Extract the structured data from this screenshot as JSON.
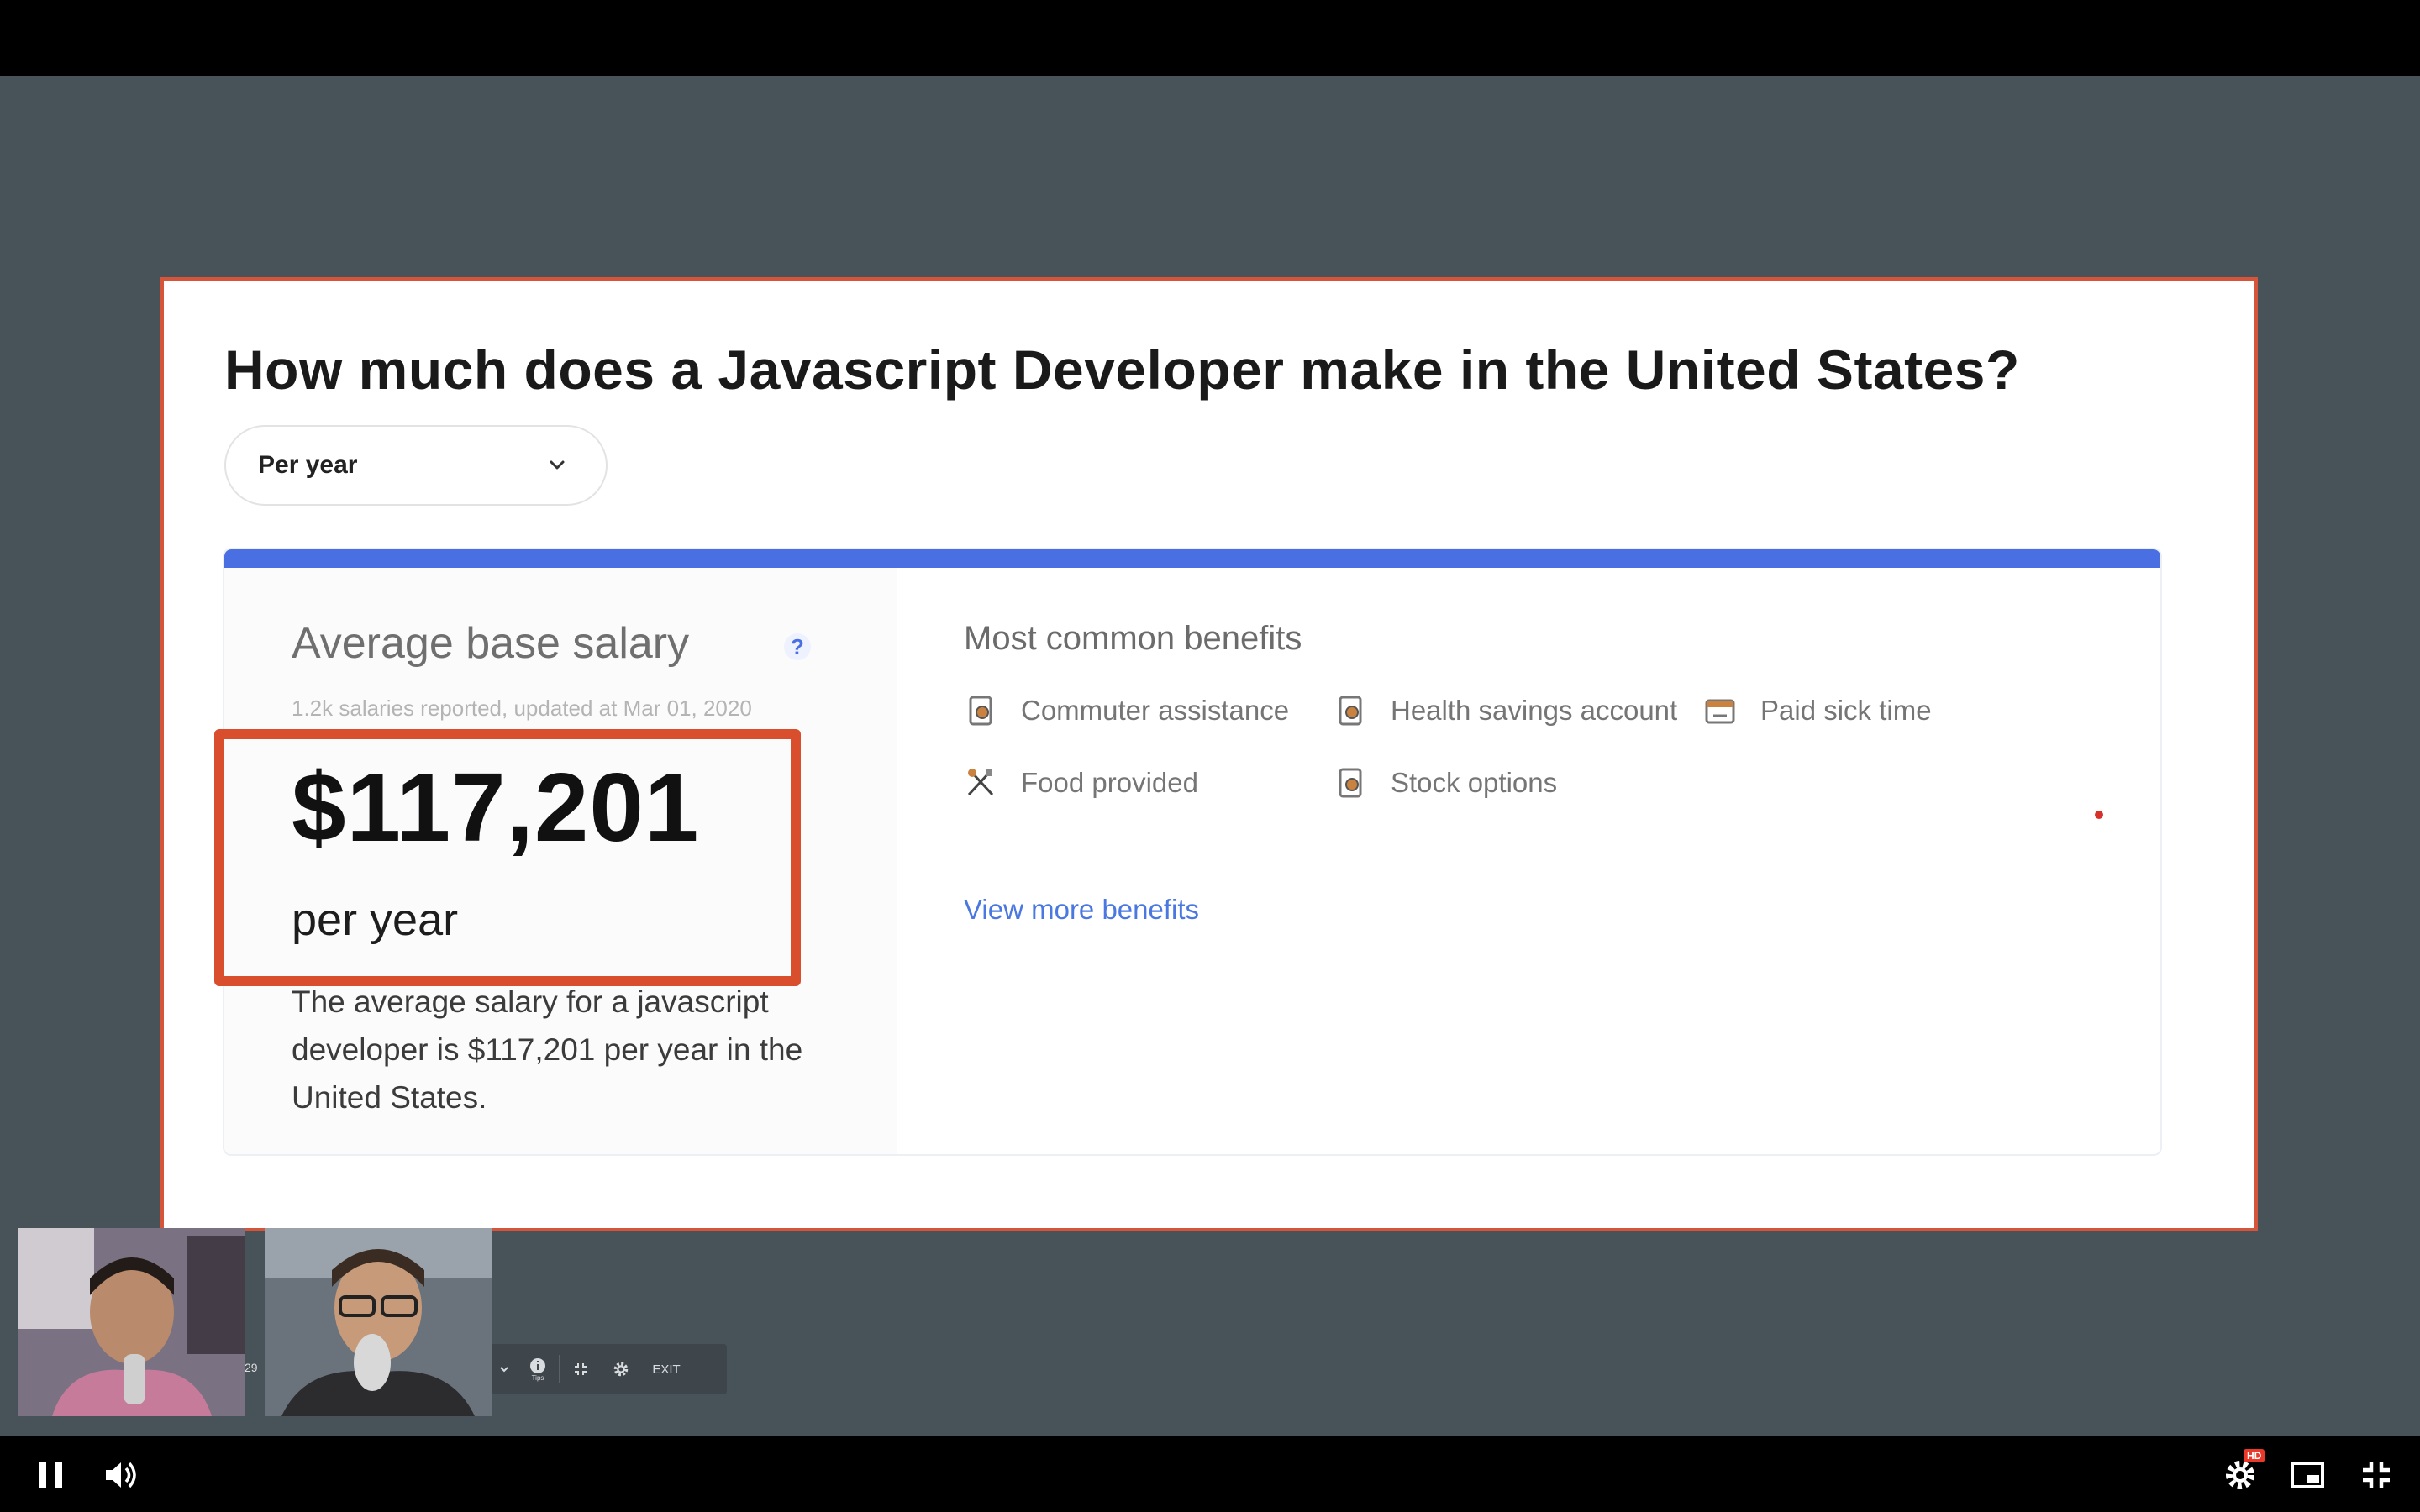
{
  "slide": {
    "title": "How much does a Javascript Developer make in the United States?",
    "period_select": {
      "selected": "Per year"
    },
    "salary_card": {
      "heading": "Average base salary",
      "help_glyph": "?",
      "meta": "1.2k salaries reported, updated at Mar 01, 2020",
      "amount": "$117,201",
      "unit": "per year",
      "description": "The average salary for a javascript developer is $117,201 per year in the United States."
    },
    "benefits": {
      "heading": "Most common benefits",
      "items": [
        {
          "label": "Commuter assistance",
          "icon": "commuter-icon"
        },
        {
          "label": "Health savings account",
          "icon": "health-savings-icon"
        },
        {
          "label": "Paid sick time",
          "icon": "paid-sick-icon"
        },
        {
          "label": "Food provided",
          "icon": "food-icon"
        },
        {
          "label": "Stock options",
          "icon": "stock-options-icon"
        }
      ],
      "view_more": "View more benefits"
    }
  },
  "webcams": {
    "counter": "29"
  },
  "mini_toolbar": {
    "exit_label": "EXIT",
    "info_sub": "Tips"
  },
  "player": {
    "hd_badge": "HD"
  },
  "colors": {
    "accent_blue": "#4a6fe3",
    "highlight_red": "#d94e2c",
    "backdrop": "#485259",
    "link_blue": "#4a78e0"
  }
}
